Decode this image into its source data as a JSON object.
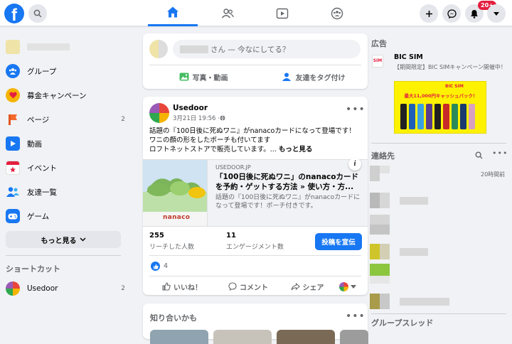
{
  "header": {
    "logo_letter": "f",
    "notif_badge": "20+"
  },
  "sidebar": {
    "items": [
      {
        "label": "グループ",
        "count": ""
      },
      {
        "label": "募金キャンペーン",
        "count": ""
      },
      {
        "label": "ページ",
        "count": "2"
      },
      {
        "label": "動画",
        "count": ""
      },
      {
        "label": "イベント",
        "count": ""
      },
      {
        "label": "友達一覧",
        "count": ""
      },
      {
        "label": "ゲーム",
        "count": ""
      }
    ],
    "more_label": "もっと見る",
    "shortcuts_title": "ショートカット",
    "shortcut": {
      "label": "Usedoor",
      "count": "2"
    }
  },
  "composer": {
    "placeholder": "さん — 今なにしてる？",
    "photo_label": "写真・動画",
    "tag_label": "友達をタグ付け"
  },
  "post": {
    "author": "Usedoor",
    "time": "3月21日 19:56 · ",
    "text_lines": [
      "話題の『100日後に死ぬワニ』がnanacoカードになって登場です！",
      "ワニの顔の形をしたポーチも付いてます",
      "ロフトネットストアで販売しています。..."
    ],
    "see_more": "もっと見る",
    "link": {
      "domain": "USEDOOR.JP",
      "title": "「100日後に死ぬワニ」のnanacoカードを予約・ゲットする方法 » 使い方・方...",
      "desc": "話題の『100日後に死ぬワニ』がnanacoカードになって登場です！ポーチ付きです。",
      "image_text": "nanaco"
    },
    "stats": {
      "reach_value": "255",
      "reach_label": "リーチした人数",
      "engage_value": "11",
      "engage_label": "エンゲージメント数",
      "boost_label": "投稿を宣伝"
    },
    "reactions_count": "4",
    "actions": {
      "like": "いいね！",
      "comment": "コメント",
      "share": "シェア"
    }
  },
  "pymk": {
    "title": "知り合いかも"
  },
  "rightcol": {
    "ads_title": "広告",
    "ad_brand": "BIC SIM",
    "ad_text": "【期間限定】BIC SIMキャンペーン開催中！",
    "ad_banner_big": "最大11,000円キャッシュバック！",
    "ad_banner_logo": "BIC SIM",
    "contacts_title": "連絡先",
    "contact_time": "20時間前",
    "group_threads": "グループスレッド"
  },
  "colors": {
    "brand": "#1877f2",
    "badge": "#e41e3f"
  }
}
